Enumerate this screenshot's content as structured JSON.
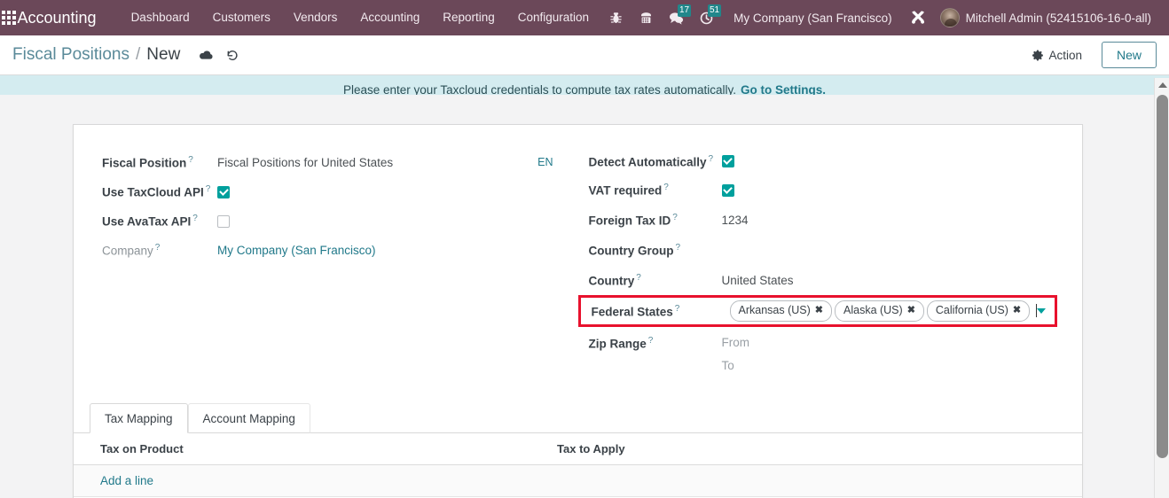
{
  "navbar": {
    "apps_icon": "grid-apps-icon",
    "brand": "Accounting",
    "menus": [
      {
        "label": "Dashboard"
      },
      {
        "label": "Customers"
      },
      {
        "label": "Vendors"
      },
      {
        "label": "Accounting"
      },
      {
        "label": "Reporting"
      },
      {
        "label": "Configuration"
      }
    ],
    "icons": [
      {
        "name": "bug-icon",
        "glyph": "🐞",
        "badge": null
      },
      {
        "name": "phone-icon",
        "glyph": "☎",
        "badge": null
      },
      {
        "name": "messages-icon",
        "glyph": "💬",
        "badge": "17"
      },
      {
        "name": "activities-clock-icon",
        "glyph": "◴",
        "badge": "51"
      }
    ],
    "company": "My Company (San Francisco)",
    "tools_icon": "wrench-screwdriver-icon",
    "user": "Mitchell Admin (52415106-16-0-all)",
    "brand_color": "#6b4859",
    "badge_color": "#21878b"
  },
  "control_panel": {
    "breadcrumb_root": "Fiscal Positions",
    "breadcrumb_sep": "/",
    "breadcrumb_current": "New",
    "save_icon": "cloud-save-icon",
    "discard_icon": "undo-discard-icon",
    "action_label": "Action",
    "action_icon": "gear-icon",
    "new_label": "New"
  },
  "alert": {
    "text": "Please enter your Taxcloud credentials to compute tax rates automatically.",
    "link": "Go to Settings.",
    "bg_color": "#d4ecf0"
  },
  "form": {
    "left": {
      "fiscal_position": {
        "label": "Fiscal Position",
        "value": "Fiscal Positions for United States",
        "lang": "EN"
      },
      "use_taxcloud": {
        "label": "Use TaxCloud API",
        "checked": true
      },
      "use_avatax": {
        "label": "Use AvaTax API",
        "checked": false
      },
      "company": {
        "label": "Company",
        "value": "My Company (San Francisco)"
      }
    },
    "right": {
      "detect_automatically": {
        "label": "Detect Automatically",
        "checked": true
      },
      "vat_required": {
        "label": "VAT required",
        "checked": true
      },
      "foreign_tax_id": {
        "label": "Foreign Tax ID",
        "value": "1234"
      },
      "country_group": {
        "label": "Country Group",
        "value": ""
      },
      "country": {
        "label": "Country",
        "value": "United States"
      },
      "federal_states": {
        "label": "Federal States",
        "tags": [
          "Arkansas (US)",
          "Alaska (US)",
          "California (US)"
        ],
        "remove_glyph": "✖",
        "highlight_color": "#e8112d",
        "caret_icon": "chevron-down-icon"
      },
      "zip_range": {
        "label": "Zip Range",
        "from_placeholder": "From",
        "to_placeholder": "To"
      }
    },
    "help_marker": "?"
  },
  "notebook": {
    "tabs": [
      {
        "label": "Tax Mapping",
        "active": true
      },
      {
        "label": "Account Mapping",
        "active": false
      }
    ],
    "table": {
      "columns": [
        "Tax on Product",
        "Tax to Apply"
      ],
      "rows": [],
      "add_line_label": "Add a line"
    }
  },
  "scrollbar": {
    "up_arrow_icon": "scroll-up-arrow-icon",
    "thumb_color": "#8b8b8b"
  }
}
